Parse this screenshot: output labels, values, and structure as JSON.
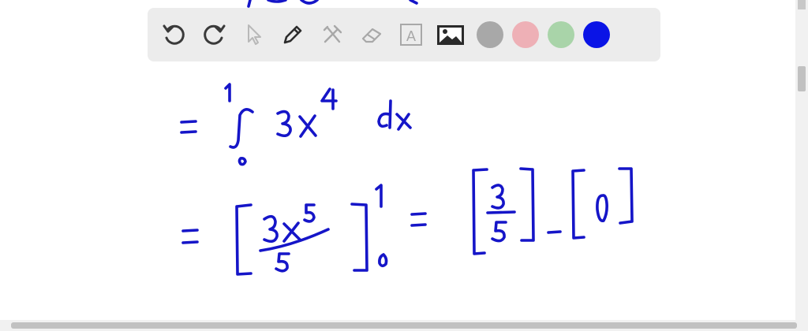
{
  "toolbar": {
    "tools": [
      {
        "name": "undo-icon",
        "active": true
      },
      {
        "name": "redo-icon",
        "active": true
      },
      {
        "name": "select-pointer-icon",
        "active": false
      },
      {
        "name": "pen-icon",
        "active": true
      },
      {
        "name": "tools-icon",
        "active": false
      },
      {
        "name": "eraser-icon",
        "active": false
      },
      {
        "name": "text-tool-icon",
        "active": false,
        "label": "A"
      },
      {
        "name": "image-icon",
        "active": true
      }
    ],
    "colors": [
      {
        "name": "gray",
        "hex": "#a8a8a8"
      },
      {
        "name": "pink",
        "hex": "#eeb0b6"
      },
      {
        "name": "green",
        "hex": "#a9d4a9"
      },
      {
        "name": "blue",
        "hex": "#0a14e6",
        "selected": true
      }
    ]
  },
  "ink_color": "#1515c8",
  "content": {
    "line1": {
      "equals": "=",
      "upper_limit": "1",
      "lower_limit": "0",
      "integrand": "3x",
      "exponent": "4",
      "differential": "dx"
    },
    "line2": {
      "equals": "=",
      "numerator": "3x",
      "numerator_exponent": "5",
      "denominator": "5",
      "upper_limit": "1",
      "lower_limit": "0",
      "equals2": "=",
      "result_numerator": "3",
      "result_denominator": "5",
      "minus": "-",
      "zero_term": "0"
    }
  }
}
